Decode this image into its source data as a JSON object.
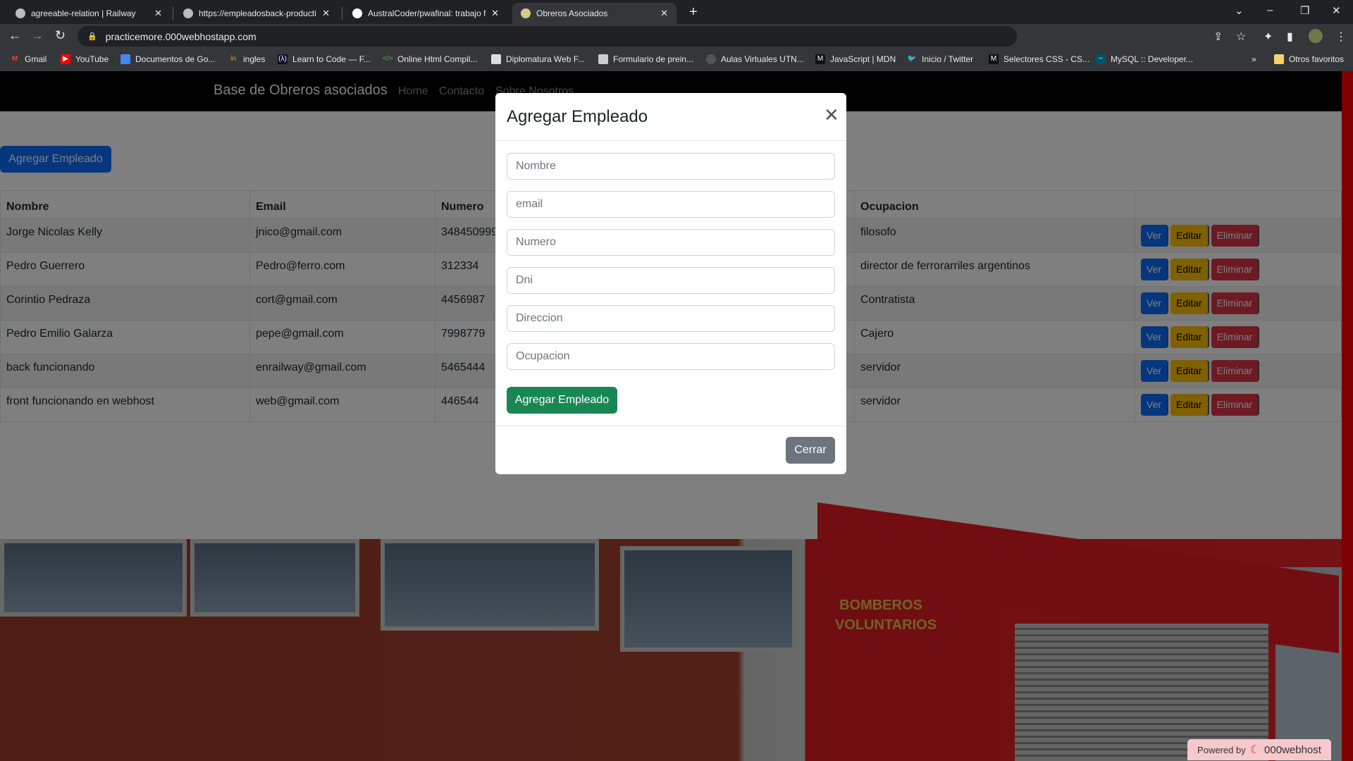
{
  "browser": {
    "tabs": [
      {
        "title": "agreeable-relation | Railway"
      },
      {
        "title": "https://empleadosback-producti"
      },
      {
        "title": "AustralCoder/pwafinal: trabajo fi"
      },
      {
        "title": "Obreros Asociados"
      }
    ],
    "url": "practicemore.000webhostapp.com",
    "bookmarks": [
      "Gmail",
      "YouTube",
      "Documentos de Go...",
      "ingles",
      "Learn to Code — F...",
      "Online Html Compil...",
      "Diplomatura Web F...",
      "Formulario de prein...",
      "Aulas Virtuales UTN...",
      "JavaScript | MDN",
      "Inicio / Twitter",
      "Selectores CSS - CS...",
      "MySQL :: Developer..."
    ],
    "other_bookmarks": "Otros favoritos"
  },
  "navbar": {
    "brand": "Base de Obreros asociados",
    "links": [
      "Home",
      "Contacto",
      "Sobre Nosotros"
    ]
  },
  "main": {
    "add_button": "Agregar Empleado",
    "table": {
      "headers": [
        "Nombre",
        "Email",
        "Numero",
        "",
        "",
        "Ocupacion",
        ""
      ],
      "rows": [
        {
          "nombre": "Jorge Nicolas Kelly",
          "email": "jnico@gmail.com",
          "numero": "348450999",
          "ocupacion": "filosofo"
        },
        {
          "nombre": "Pedro Guerrero",
          "email": "Pedro@ferro.com",
          "numero": "312334",
          "ocupacion": "director de ferrorarriles argentinos"
        },
        {
          "nombre": "Corintio Pedraza",
          "email": "cort@gmail.com",
          "numero": "4456987",
          "ocupacion": "Contratista"
        },
        {
          "nombre": "Pedro Emilio Galarza",
          "email": "pepe@gmail.com",
          "numero": "7998779",
          "ocupacion": "Cajero"
        },
        {
          "nombre": "back funcionando",
          "email": "enrailway@gmail.com",
          "numero": "5465444",
          "ocupacion": "servidor"
        },
        {
          "nombre": "front funcionando en webhost",
          "email": "web@gmail.com",
          "numero": "446544",
          "ocupacion": "servidor"
        }
      ],
      "actions": {
        "view": "Ver",
        "edit": "Editar",
        "delete": "Eliminar"
      }
    },
    "photo_sign": "BOMBEROS VOLUNTARIOS"
  },
  "modal": {
    "title": "Agregar Empleado",
    "placeholders": [
      "Nombre",
      "email",
      "Numero",
      "Dni",
      "Direccion",
      "Ocupacion"
    ],
    "submit": "Agregar Empleado",
    "close": "Cerrar"
  },
  "footer": {
    "powered_by": "Powered by",
    "host": "000webhost"
  },
  "colors": {
    "primary": "#0d6efd",
    "warning": "#ffc107",
    "danger": "#dc3545",
    "success": "#198754",
    "secondary": "#6c757d"
  }
}
